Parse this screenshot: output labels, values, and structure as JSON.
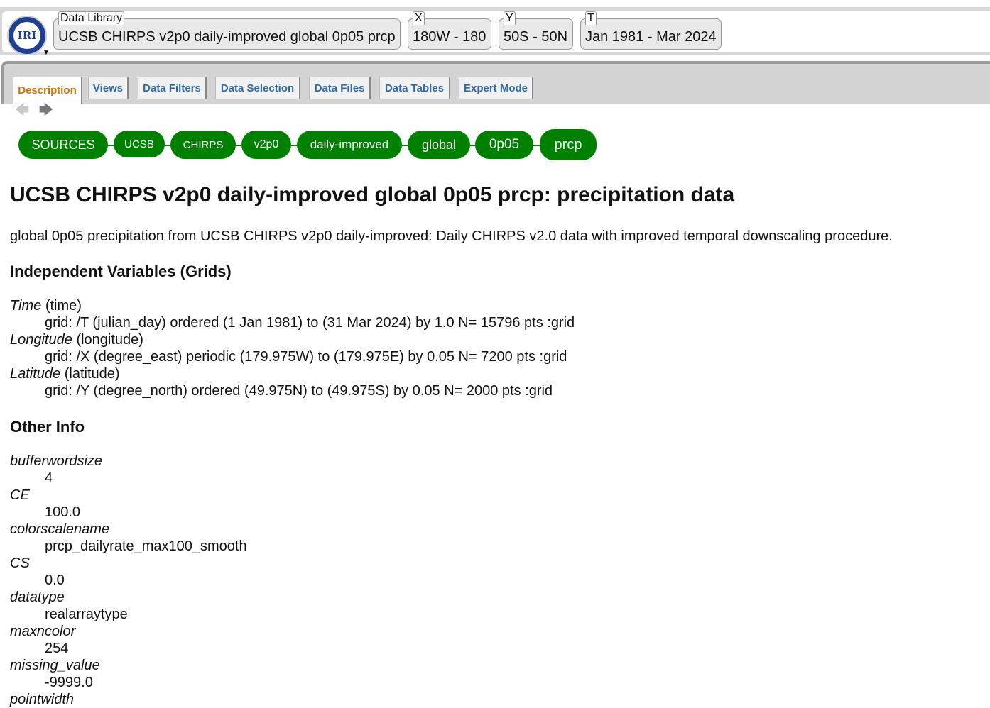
{
  "header": {
    "logo_text": "IRI",
    "dataset_label": "Data Library",
    "dataset_value": "UCSB CHIRPS v2p0 daily-improved global 0p05 prcp",
    "x_label": "X",
    "x_value": "180W - 180",
    "y_label": "Y",
    "y_value": "50S - 50N",
    "t_label": "T",
    "t_value": "Jan 1981 - Mar 2024"
  },
  "tabs": [
    "Description",
    "Views",
    "Data Filters",
    "Data Selection",
    "Data Files",
    "Data Tables",
    "Expert Mode"
  ],
  "breadcrumbs": [
    "SOURCES",
    "UCSB",
    "CHIRPS",
    "v2p0",
    "daily-improved",
    "global",
    "0p05",
    "prcp"
  ],
  "main": {
    "title": "UCSB CHIRPS v2p0 daily-improved global 0p05 prcp: precipitation data",
    "description": "global 0p05 precipitation from UCSB CHIRPS v2p0 daily-improved: Daily CHIRPS v2.0 data with improved temporal downscaling procedure.",
    "independent_heading": "Independent Variables (Grids)",
    "variables": [
      {
        "name": "Time",
        "paren": "(time)",
        "grid": "grid: /T (julian_day) ordered (1 Jan 1981) to (31 Mar 2024) by 1.0 N= 15796 pts :grid"
      },
      {
        "name": "Longitude",
        "paren": "(longitude)",
        "grid": "grid: /X (degree_east) periodic (179.975W) to (179.975E) by 0.05 N= 7200 pts :grid"
      },
      {
        "name": "Latitude",
        "paren": "(latitude)",
        "grid": "grid: /Y (degree_north) ordered (49.975N) to (49.975S) by 0.05 N= 2000 pts :grid"
      }
    ],
    "other_heading": "Other Info",
    "other_info": [
      {
        "key": "bufferwordsize",
        "value": "4"
      },
      {
        "key": "CE",
        "value": "100.0"
      },
      {
        "key": "colorscalename",
        "value": "prcp_dailyrate_max100_smooth"
      },
      {
        "key": "CS",
        "value": "0.0"
      },
      {
        "key": "datatype",
        "value": "realarraytype"
      },
      {
        "key": "maxncolor",
        "value": "254"
      },
      {
        "key": "missing_value",
        "value": "-9999.0"
      },
      {
        "key": "pointwidth",
        "value": ""
      }
    ]
  }
}
